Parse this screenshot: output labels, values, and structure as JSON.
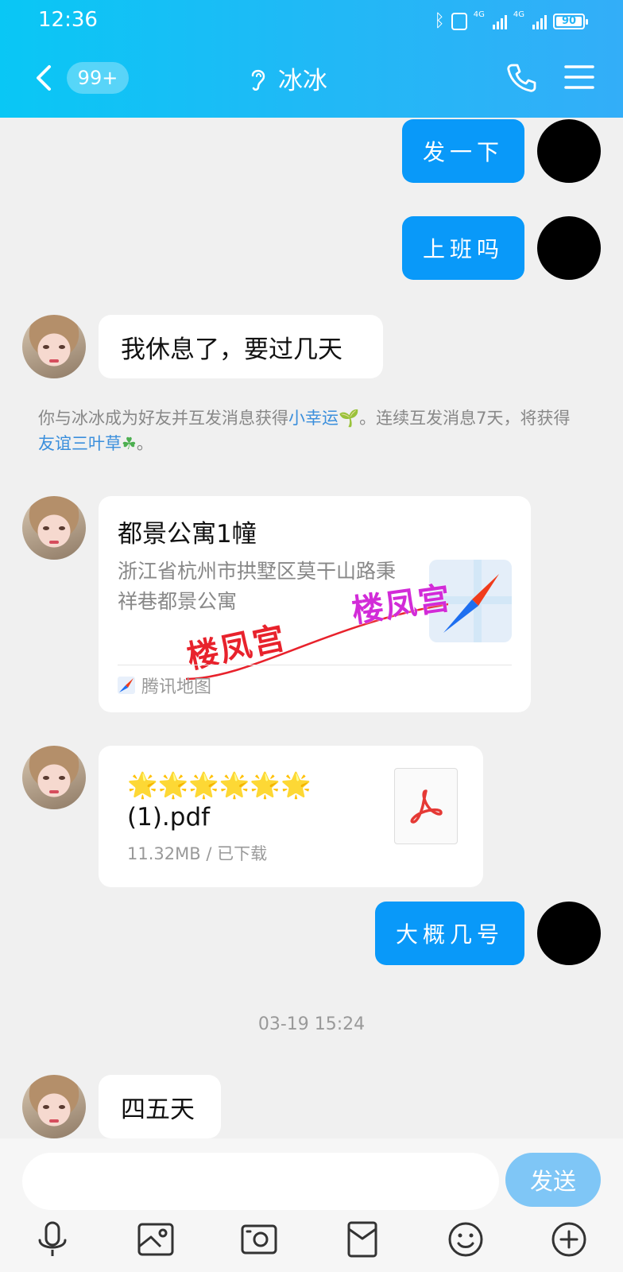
{
  "status_bar": {
    "time": "12:36",
    "network_1": "4G",
    "network_2": "4G",
    "battery": "90"
  },
  "header": {
    "unread_count": "99+",
    "title": "冰冰",
    "icons": [
      "back-icon",
      "ear-icon",
      "phone-icon",
      "menu-icon"
    ]
  },
  "messages": {
    "m1": "发一下",
    "m2": "上班吗",
    "m3": "我休息了，要过几天",
    "m7": "大概几号",
    "m8": "四五天"
  },
  "system_notice": {
    "part1": "你与冰冰成为好友并互发消息获得",
    "link1": "小幸运",
    "part2": "。连续互发消息7天，将获得",
    "link2": "友谊三叶草",
    "part3": "。"
  },
  "location_card": {
    "title": "都景公寓1幢",
    "address": "浙江省杭州市拱墅区莫干山路秉祥巷都景公寓",
    "source": "腾讯地图",
    "watermark": "楼凤宫"
  },
  "file_card": {
    "name": "🌟🌟🌟🌟🌟🌟(1).pdf",
    "meta": "11.32MB / 已下载"
  },
  "timestamp": "03-19 15:24",
  "input": {
    "value": "",
    "send_label": "发送"
  },
  "toolbar": [
    "microphone-icon",
    "image-icon",
    "camera-icon",
    "red-packet-icon",
    "emoji-icon",
    "plus-icon"
  ],
  "colors": {
    "header_gradient_start": "#09c7f5",
    "header_gradient_end": "#33aef8",
    "self_bubble": "#0999f9",
    "link": "#3b8fdc",
    "send_button": "#7fc6f6"
  }
}
